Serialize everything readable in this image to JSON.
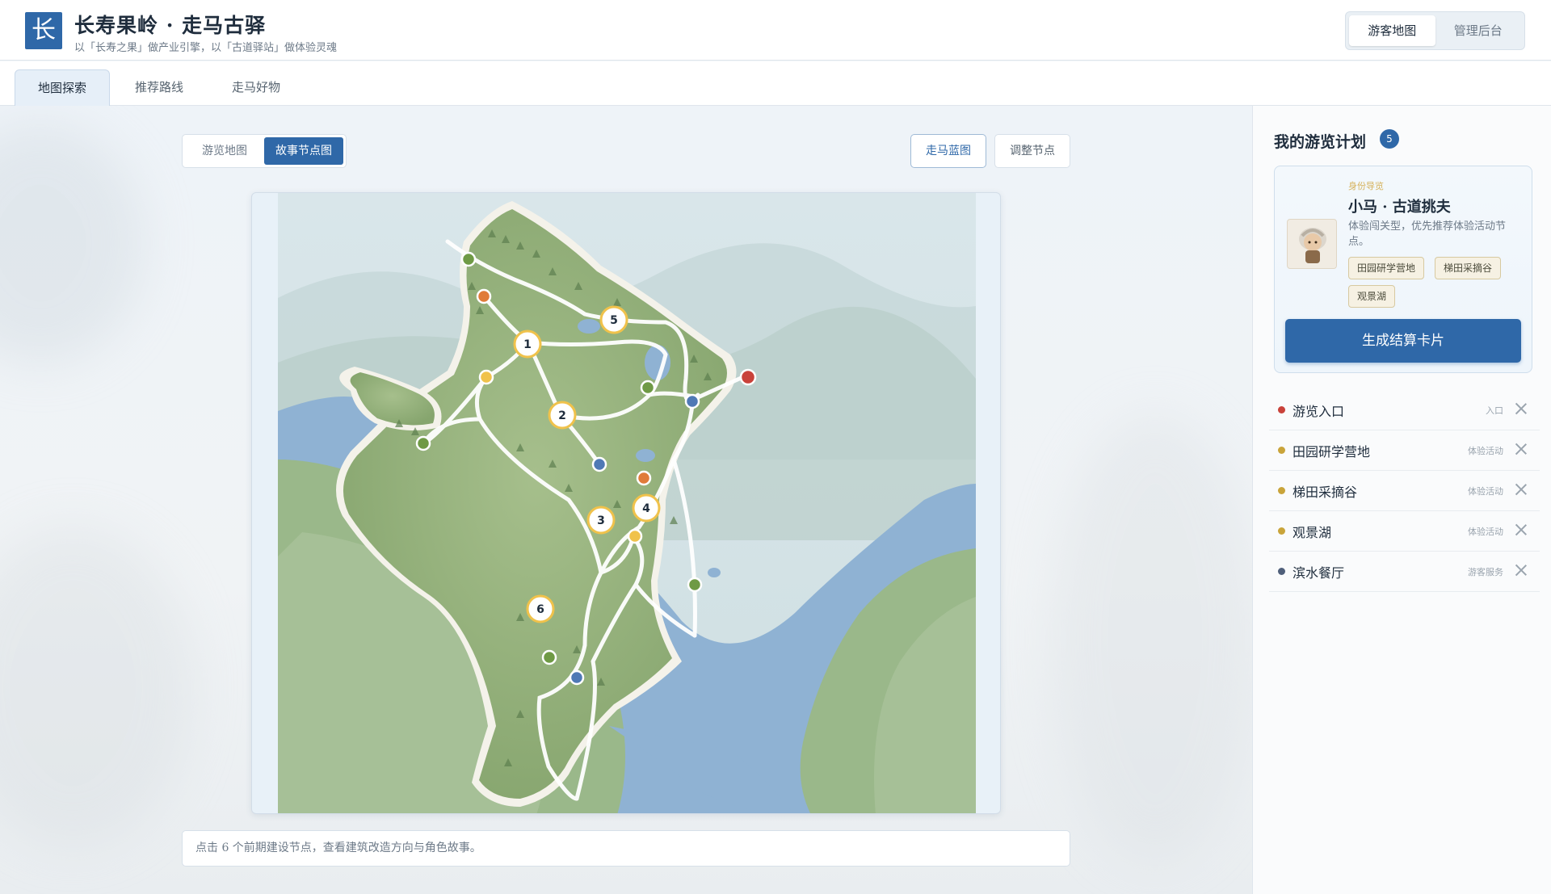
{
  "header": {
    "logo_char": "长",
    "title": "长寿果岭 · 走马古驿",
    "subtitle": "以「长寿之果」做产业引擎，以「古道驿站」做体验灵魂",
    "mode_switch": [
      "游客地图",
      "管理后台"
    ],
    "active_mode": "游客地图"
  },
  "tabs": [
    {
      "label": "地图探索",
      "active": true
    },
    {
      "label": "推荐路线",
      "active": false
    },
    {
      "label": "走马好物",
      "active": false
    }
  ],
  "map_view": {
    "view_toggle": [
      "游览地图",
      "故事节点图"
    ],
    "active_view": "故事节点图",
    "tools": [
      "走马蓝图",
      "调整节点"
    ],
    "story_node_labels": [
      "1",
      "2",
      "3",
      "4",
      "5",
      "6"
    ],
    "hint": "点击 6 个前期建设节点，查看建筑改造方向与角色故事。"
  },
  "colors": {
    "accent": "#2f68a8",
    "node_red": "#c9423a",
    "node_orange": "#e07b39",
    "node_yellow": "#f0c24b",
    "node_green": "#6f9a45",
    "node_blue": "#4f79b5"
  },
  "panel": {
    "title": "我的游览计划",
    "count": "5",
    "role_tag": "身份导览",
    "role_name": "小马 · 古道挑夫",
    "role_desc": "体验闯关型，优先推荐体验活动节点。",
    "chips": [
      "田园研学营地",
      "梯田采摘谷",
      "观景湖"
    ],
    "generate_button": "生成结算卡片",
    "plan_items": [
      {
        "name": "游览入口",
        "type": "入口",
        "color": "#c9423a"
      },
      {
        "name": "田园研学营地",
        "type": "体验活动",
        "color": "#c9a43a"
      },
      {
        "name": "梯田采摘谷",
        "type": "体验活动",
        "color": "#c9a43a"
      },
      {
        "name": "观景湖",
        "type": "体验活动",
        "color": "#c9a43a"
      },
      {
        "name": "滨水餐厅",
        "type": "游客服务",
        "color": "#4f5f7a"
      }
    ]
  }
}
